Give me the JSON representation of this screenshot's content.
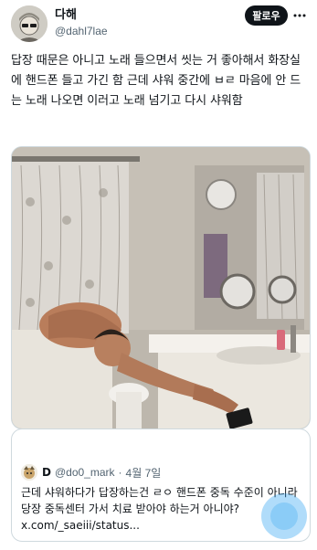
{
  "author": {
    "display_name": "다해",
    "handle": "@dahl7lae"
  },
  "follow_label": "팔로우",
  "tweet_text": "답장 때문은 아니고 노래 들으면서 씻는 거 좋아해서 화장실에 핸드폰 들고 가긴 함 근데 샤워 중간에 ㅂㄹ 마음에 안 드는 노래 나오면 이러고 노래 넘기고 다시 샤워함",
  "quoted_tweet": {
    "display_name": "D",
    "handle": "@do0_mark",
    "separator": "·",
    "date": "4월 7일",
    "text": "근데 샤워하다가 답장하는건 ㄹㅇ 핸드폰 중독 수준이 아니라 당장 중독센터 가서 치료 받아야 하는거 아니야? x.com/_saeiii/status..."
  },
  "icons": {
    "more": "more-horizontal-icon",
    "fab": "scroll-fab-icon"
  },
  "colors": {
    "text": "#0f1419",
    "secondary": "#536471",
    "border": "#cfd9de",
    "button": "#0f1419",
    "accent": "#1d9bf0"
  }
}
